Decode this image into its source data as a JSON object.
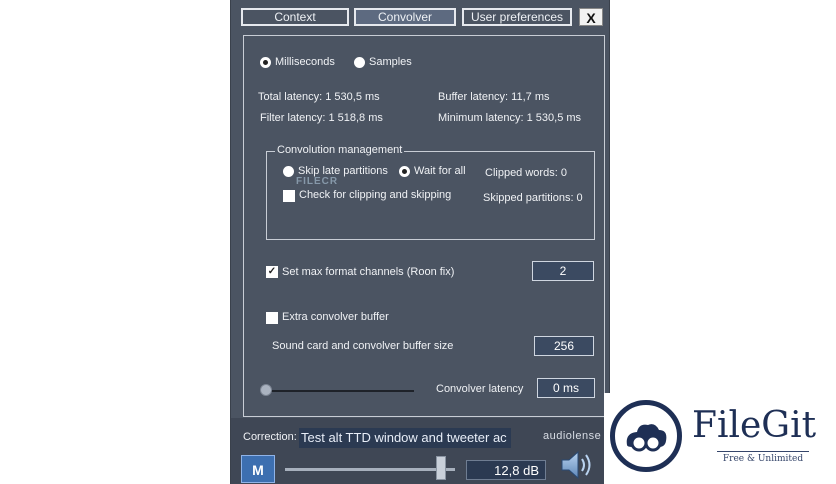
{
  "tabs": [
    {
      "label": "Context",
      "active": false
    },
    {
      "label": "Convolver",
      "active": true
    },
    {
      "label": "User preferences",
      "active": false
    }
  ],
  "close_label": "X",
  "units": {
    "milliseconds_label": "Milliseconds",
    "samples_label": "Samples",
    "selected": "Milliseconds"
  },
  "latency": {
    "total": "Total latency: 1 530,5 ms",
    "filter": "Filter latency: 1 518,8 ms",
    "buffer": "Buffer latency: 11,7 ms",
    "minimum": "Minimum latency: 1 530,5 ms"
  },
  "convolution_management": {
    "title": "Convolution management",
    "skip_label": "Skip late partitions",
    "wait_label": "Wait for all",
    "selected": "Wait for all",
    "clipped_words": "Clipped words: 0",
    "skipped_partitions": "Skipped partitions: 0",
    "check_clipping_label": "Check for clipping and skipping",
    "check_clipping": false
  },
  "max_channels": {
    "label": "Set max format channels (Roon fix)",
    "checked": true,
    "value": "2"
  },
  "extra_buffer": {
    "label": "Extra convolver buffer",
    "checked": false
  },
  "buffer_size": {
    "label": "Sound card and convolver buffer size",
    "value": "256"
  },
  "convolver_latency": {
    "label": "Convolver latency",
    "value": "0 ms",
    "slider_fraction": 0
  },
  "correction": {
    "label": "Correction:",
    "value": "Test alt TTD window and tweeter ac"
  },
  "brand": "audiolense",
  "mute_label": "M",
  "volume": {
    "value": "12,8 dB",
    "slider_fraction": 0.92
  },
  "watermark_text": "FILECR",
  "logo": {
    "title": "FileGit",
    "tagline": "Free & Unlimited"
  },
  "icons": {
    "speaker": "speaker-icon",
    "logo_mark": "filegit-logo-icon"
  }
}
